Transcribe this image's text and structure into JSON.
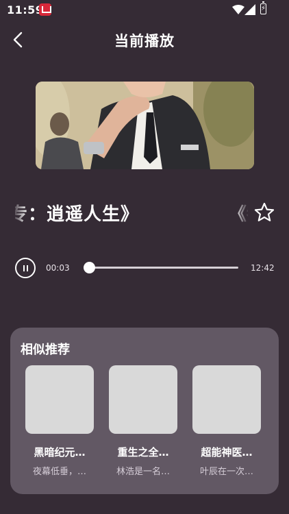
{
  "status_bar": {
    "time": "11:59",
    "battery_symbol": "⚡",
    "icons": [
      "app-badge-icon",
      "wifi-icon",
      "signal-icon",
      "battery-icon"
    ]
  },
  "header": {
    "title": "当前播放",
    "back_icon": "chevron-left-icon"
  },
  "now_playing": {
    "title_text": "专：逍遥人生》",
    "title_repeat_text": "《都",
    "favorite_icon": "star-outline-icon"
  },
  "player": {
    "current_time": "00:03",
    "total_time": "12:42",
    "progress_fraction": 0.004,
    "play_state_icon": "pause-icon"
  },
  "recommendations": {
    "title": "相似推荐",
    "items": [
      {
        "name": "黑暗纪元…",
        "desc": "夜幕低垂，…"
      },
      {
        "name": "重生之全…",
        "desc": "林浩是一名…"
      },
      {
        "name": "超能神医…",
        "desc": "叶辰在一次…"
      }
    ]
  },
  "colors": {
    "background": "#352b35",
    "panel": "#625864",
    "placeholder": "#d9d9d9",
    "text": "#ffffff"
  }
}
